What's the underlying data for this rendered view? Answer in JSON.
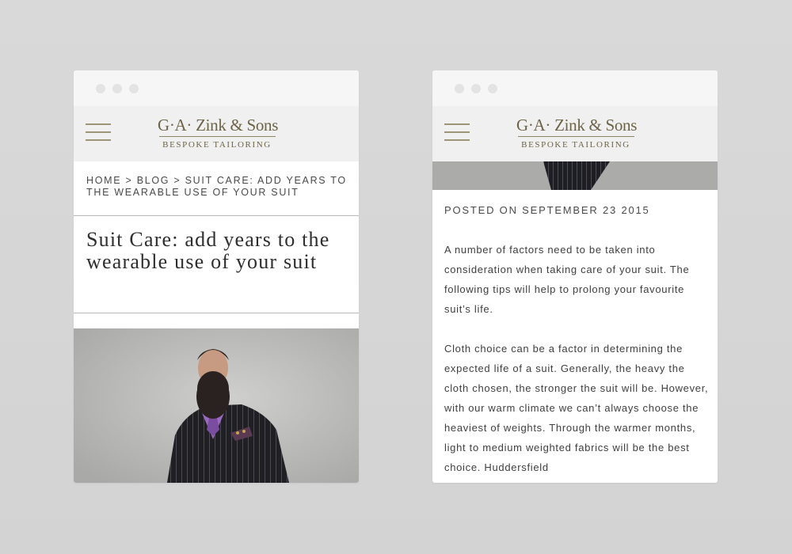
{
  "site": {
    "logo_name": "G·A· Zink & Sons",
    "logo_tagline": "BESPOKE TAILORING"
  },
  "left_screen": {
    "breadcrumb": {
      "home": "HOME",
      "separator": ">",
      "blog": "BLOG",
      "current": "SUIT CARE: ADD YEARS TO THE WEARABLE USE OF YOUR SUIT"
    },
    "post_title": "Suit Care: add years to the wearable use of your suit"
  },
  "right_screen": {
    "posted_on": "POSTED ON SEPTEMBER 23 2015",
    "paragraphs": [
      "A number of factors need to be taken into consideration when taking care of your suit. The following tips will help to prolong your favourite suit’s life.",
      "Cloth choice can be a factor in determining the expected life of a suit. Generally, the heavy the cloth chosen, the stronger the suit will be. However,  with our warm climate we can’t always choose the heaviest of weights. Through the warmer months, light to medium weighted fabrics will be the best choice. Huddersfield"
    ]
  },
  "colors": {
    "brand_gold": "#9e9476",
    "header_bg": "#f0f0f0",
    "browser_chrome": "#f6f6f6",
    "text": "#3f3f3f"
  },
  "icons": {
    "menu": "hamburger-icon",
    "window_controls": "dot-icon"
  }
}
